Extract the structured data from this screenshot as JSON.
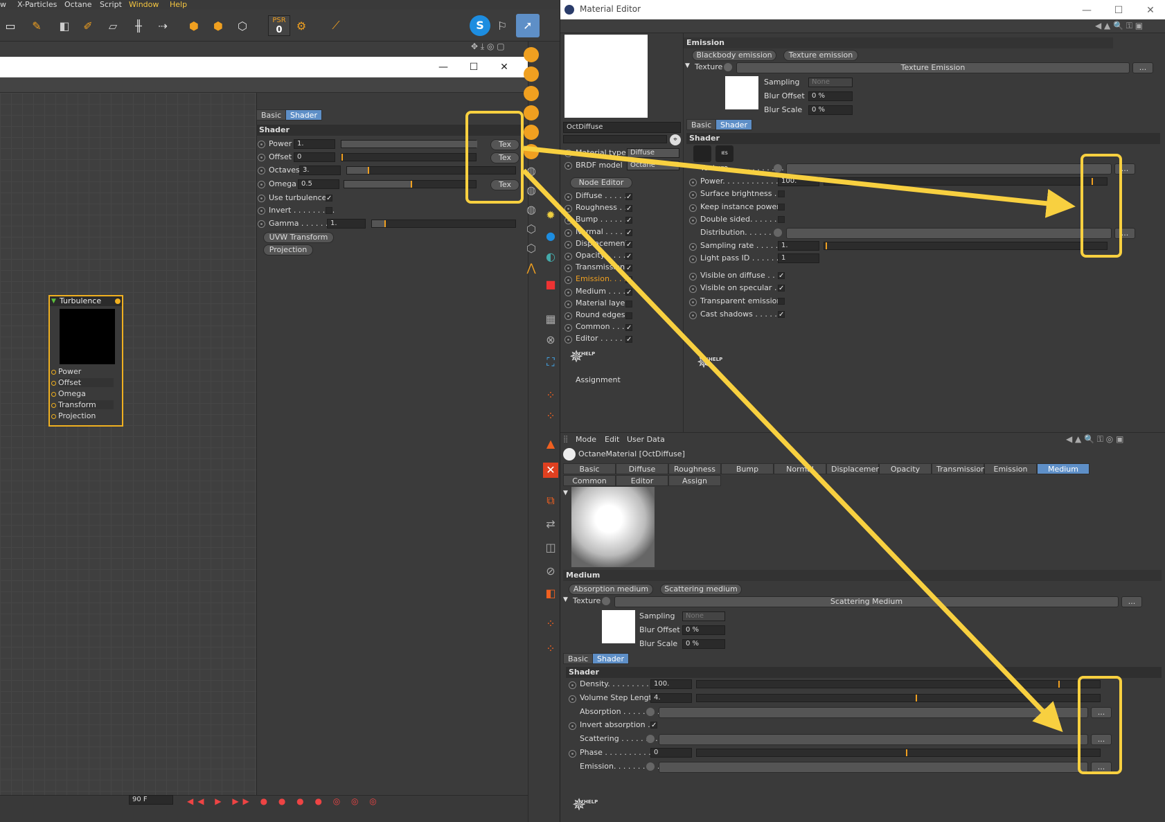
{
  "menubar": {
    "items": [
      "w",
      "X-Particles",
      "Octane",
      "Script",
      "Window",
      "Help"
    ]
  },
  "toolbar": {
    "psr_label": "PSR",
    "psr_value": "0",
    "xyz": "X Y Z"
  },
  "node_window": {
    "tabs": [
      "Basic",
      "Shader"
    ],
    "active_tab": "Shader",
    "section": "Shader",
    "params": [
      {
        "label": "Power",
        "value": "1.",
        "tex": "Tex"
      },
      {
        "label": "Offset",
        "value": "0",
        "tex": "Tex"
      },
      {
        "label": "Octaves",
        "value": "3."
      },
      {
        "label": "Omega",
        "value": "0.5",
        "tex": "Tex"
      },
      {
        "label": "Use turbulence",
        "checked": true
      },
      {
        "label": "Invert . . . . . . . . .",
        "checked": false
      },
      {
        "label": "Gamma . . . . . . .",
        "value": "1."
      }
    ],
    "buttons": [
      "UVW Transform",
      "Projection"
    ],
    "node": {
      "title": "Turbulence",
      "ports": [
        "Power",
        "Offset",
        "Omega",
        "Transform",
        "Projection"
      ]
    },
    "bottom_field": "90 F"
  },
  "material_editor": {
    "title": "Material Editor",
    "material_name": "OctDiffuse",
    "material_type_label": "Material type",
    "material_type": "Diffuse",
    "brdf_label": "BRDF model",
    "brdf": "Octane",
    "node_editor": "Node Editor",
    "channels": [
      {
        "label": "Diffuse . . . . .",
        "checked": true
      },
      {
        "label": "Roughness . .",
        "checked": true
      },
      {
        "label": "Bump . . . . . .",
        "checked": true
      },
      {
        "label": "Normal . . . . .",
        "checked": true
      },
      {
        "label": "Displacement",
        "checked": true
      },
      {
        "label": "Opacity. . . . .",
        "checked": true
      },
      {
        "label": "Transmission",
        "checked": true
      },
      {
        "label": "Emission. . . .",
        "checked": true,
        "active": true
      },
      {
        "label": "Medium . . . .",
        "checked": true
      },
      {
        "label": "Material layer",
        "checked": false
      },
      {
        "label": "Round edges",
        "checked": false
      },
      {
        "label": "Common . . .",
        "checked": true
      },
      {
        "label": "Editor . . . . .",
        "checked": true
      }
    ],
    "assignment": "Assignment",
    "help": "HELP",
    "emission": {
      "section": "Emission",
      "buttons": [
        "Blackbody emission",
        "Texture emission"
      ],
      "texture_label": "Texture",
      "texture_value": "Texture Emission",
      "sampling_label": "Sampling",
      "sampling": "None",
      "blur_offset_label": "Blur Offset",
      "blur_offset": "0 %",
      "blur_scale_label": "Blur Scale",
      "blur_scale": "0 %",
      "tabs": [
        "Basic",
        "Shader"
      ],
      "shader_section": "Shader",
      "ies": "IES",
      "params": [
        {
          "label": "Texture. . . . . . . . . . . .",
          "kind": "link"
        },
        {
          "label": "Power. . . . . . . . . . . . .",
          "value": "100.",
          "kind": "slider"
        },
        {
          "label": "Surface brightness . .",
          "kind": "check",
          "checked": false
        },
        {
          "label": "Keep instance power",
          "kind": "check",
          "checked": false
        },
        {
          "label": "Double sided. . . . . . .",
          "kind": "check",
          "checked": false
        },
        {
          "label": "Distribution. . . . . . . .",
          "kind": "link"
        },
        {
          "label": "Sampling rate . . . . . .",
          "value": "1.",
          "kind": "slider"
        },
        {
          "label": "Light pass ID . . . . . .",
          "value": "1",
          "kind": "field"
        },
        {
          "label": "Visible on diffuse . . .",
          "kind": "check",
          "checked": true
        },
        {
          "label": "Visible on specular . .",
          "kind": "check",
          "checked": true
        },
        {
          "label": "Transparent emission",
          "kind": "check",
          "checked": false
        },
        {
          "label": "Cast shadows . . . . . .",
          "kind": "check",
          "checked": true
        }
      ]
    },
    "bottom": {
      "menu": [
        "Mode",
        "Edit",
        "User Data"
      ],
      "object_name": "OctaneMaterial [OctDiffuse]",
      "tabs_row1": [
        "Basic",
        "Diffuse",
        "Roughness",
        "Bump",
        "Normal",
        "Displacement",
        "Opacity",
        "Transmission",
        "Emission",
        "Medium"
      ],
      "tabs_row2": [
        "Common",
        "Editor",
        "Assign"
      ],
      "active_tab": "Medium",
      "medium_section": "Medium",
      "medium_buttons": [
        "Absorption medium",
        "Scattering medium"
      ],
      "texture_label": "Texture",
      "texture_value": "Scattering Medium",
      "sampling_label": "Sampling",
      "sampling": "None",
      "blur_offset_label": "Blur Offset",
      "blur_offset": "0 %",
      "blur_scale_label": "Blur Scale",
      "blur_scale": "0 %",
      "tabs": [
        "Basic",
        "Shader"
      ],
      "shader_section": "Shader",
      "params": [
        {
          "label": "Density. . . . . . . . . . .",
          "value": "100.",
          "kind": "slider"
        },
        {
          "label": "Volume Step Length",
          "value": "4.",
          "kind": "slider"
        },
        {
          "label": "Absorption . . . . . . . .",
          "kind": "link"
        },
        {
          "label": "Invert absorption . .",
          "kind": "check",
          "checked": true
        },
        {
          "label": "Scattering . . . . . . . .",
          "kind": "link"
        },
        {
          "label": "Phase . . . . . . . . . . . .",
          "value": "0",
          "kind": "slider"
        },
        {
          "label": "Emission. . . . . . . . . .",
          "kind": "link"
        }
      ],
      "ellipsis": "..."
    }
  },
  "colors": {
    "highlight": "#f8d040",
    "accent": "#f0a020",
    "active_tab": "#5e8fc7"
  }
}
